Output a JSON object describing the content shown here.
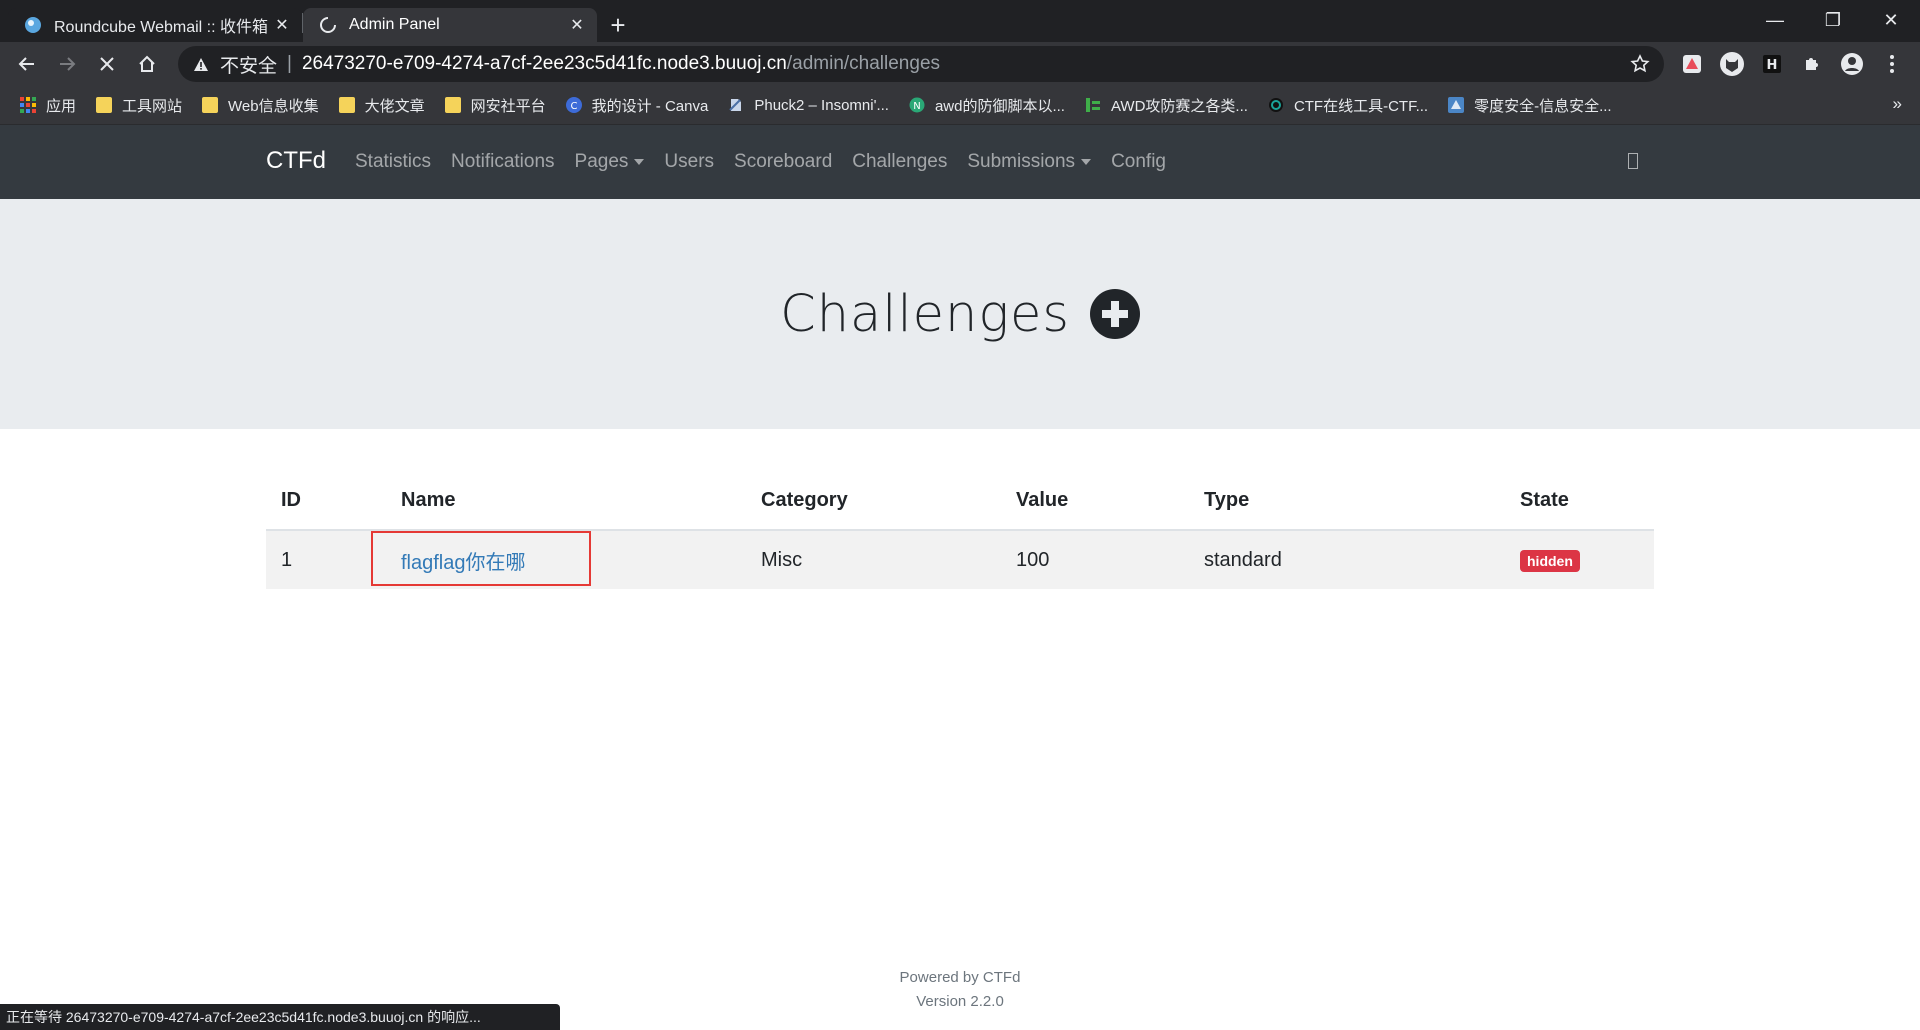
{
  "browser": {
    "tabs": [
      {
        "title": "Roundcube Webmail :: 收件箱",
        "active": false
      },
      {
        "title": "Admin Panel",
        "active": true
      }
    ],
    "address": {
      "security_label": "不安全",
      "host": "26473270-e709-4274-a7cf-2ee23c5d41fc.node3.buuoj.cn",
      "path": "/admin/challenges"
    },
    "bookmarks": [
      {
        "label": "应用",
        "icon": "apps-grid-icon"
      },
      {
        "label": "工具网站",
        "icon": "folder-icon"
      },
      {
        "label": "Web信息收集",
        "icon": "folder-icon"
      },
      {
        "label": "大佬文章",
        "icon": "folder-icon"
      },
      {
        "label": "网安社平台",
        "icon": "folder-icon"
      },
      {
        "label": "我的设计 - Canva",
        "icon": "canva-icon"
      },
      {
        "label": "Phuck2 – Insomni'...",
        "icon": "page-icon"
      },
      {
        "label": "awd的防御脚本以...",
        "icon": "n-logo-icon"
      },
      {
        "label": "AWD攻防赛之各类...",
        "icon": "bar-icon"
      },
      {
        "label": "CTF在线工具-CTF...",
        "icon": "circle-icon"
      },
      {
        "label": "零度安全-信息安全...",
        "icon": "site-icon"
      }
    ],
    "status_text": "正在等待 26473270-e709-4274-a7cf-2ee23c5d41fc.node3.buuoj.cn 的响应..."
  },
  "navbar": {
    "brand": "CTFd",
    "links": [
      "Statistics",
      "Notifications",
      "Pages",
      "Users",
      "Scoreboard",
      "Challenges",
      "Submissions",
      "Config"
    ]
  },
  "header": {
    "title": "Challenges"
  },
  "table": {
    "columns": [
      "ID",
      "Name",
      "Category",
      "Value",
      "Type",
      "State"
    ],
    "rows": [
      {
        "id": "1",
        "name": "flagflag你在哪",
        "category": "Misc",
        "value": "100",
        "type": "standard",
        "state": "hidden"
      }
    ]
  },
  "footer": {
    "powered": "Powered by CTFd",
    "version": "Version 2.2.0"
  },
  "colors": {
    "navbar_bg": "#343a40",
    "jumbotron_bg": "#e9ecef",
    "link": "#337ab7",
    "badge_danger": "#dc3545",
    "highlight_box": "#e53935"
  }
}
